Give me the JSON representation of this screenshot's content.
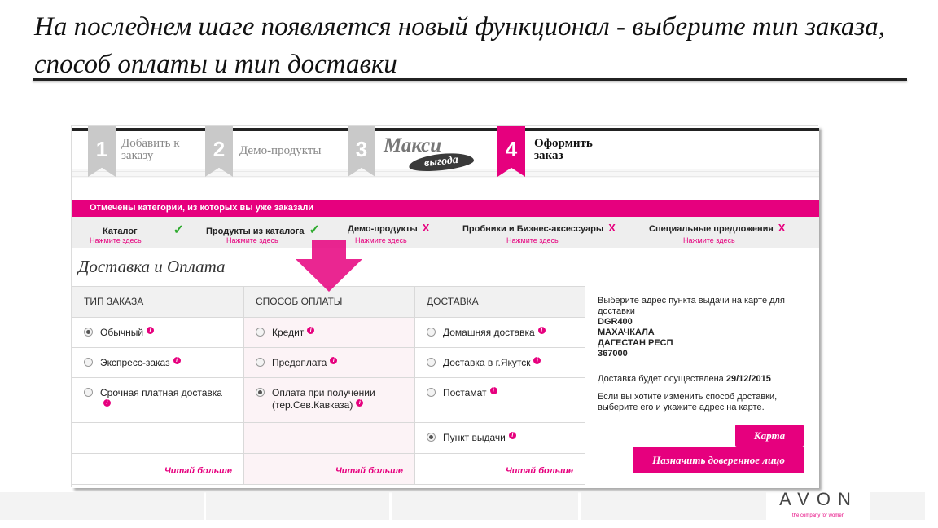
{
  "slide": {
    "title": "На последнем шаге появляется новый функционал -  выберите тип заказа, способ оплаты и тип доставки"
  },
  "steps": [
    {
      "num": "1",
      "label": "Добавить к заказу",
      "active": false
    },
    {
      "num": "2",
      "label": "Демо-продукты",
      "active": false
    },
    {
      "num": "3",
      "label": "Макси",
      "sub": "выгода",
      "active": false
    },
    {
      "num": "4",
      "label": "Оформить заказ",
      "active": true
    }
  ],
  "categories_banner": "Отмечены категории, из которых вы уже заказали",
  "categories": [
    {
      "name": "Каталог",
      "ordered": true,
      "link": "Нажмите здесь"
    },
    {
      "name": "Продукты из каталога",
      "ordered": true,
      "link": "Нажмите здесь"
    },
    {
      "name": "Демо-продукты",
      "ordered": false,
      "link": "Нажмите здесь"
    },
    {
      "name": "Пробники и Бизнес-аксессуары",
      "ordered": false,
      "link": "Нажмите здесь"
    },
    {
      "name": "Специальные предложения",
      "ordered": false,
      "link": "Нажмите здесь"
    }
  ],
  "marks": {
    "ok": "✓",
    "no": "X"
  },
  "section_title": "Доставка и Оплата",
  "columns": {
    "order_type": {
      "header": "ТИП ЗАКАЗА",
      "options": [
        {
          "label": "Обычный",
          "selected": true
        },
        {
          "label": "Экспресс-заказ",
          "selected": false
        },
        {
          "label": "Срочная платная доставка",
          "selected": false
        }
      ],
      "more": "Читай больше"
    },
    "payment": {
      "header": "СПОСОБ ОПЛАТЫ",
      "options": [
        {
          "label": "Кредит",
          "selected": false
        },
        {
          "label": "Предоплата",
          "selected": false
        },
        {
          "label": "Оплата при получении (тер.Сев.Кавказа)",
          "selected": true
        }
      ],
      "more": "Читай больше"
    },
    "delivery": {
      "header": "ДОСТАВКА",
      "options": [
        {
          "label": "Домашняя доставка",
          "selected": false
        },
        {
          "label": "Доставка в г.Якутск",
          "selected": false
        },
        {
          "label": "Постамат",
          "selected": false
        },
        {
          "label": "Пункт выдачи",
          "selected": true
        }
      ],
      "more": "Читай больше"
    }
  },
  "info_glyph": "i",
  "side": {
    "intro": "Выберите адрес пункта выдачи на карте для доставки",
    "addr1": "DGR400",
    "addr2": "МАХАЧКАЛА",
    "addr3": "ДАГЕСТАН РЕСП",
    "addr4": "367000",
    "delivery_note": "Доставка будет осуществлена",
    "delivery_date": "29/12/2015",
    "change_note": "Если вы хотите изменить способ доставки, выберите его и укажите адрес на карте.",
    "map_button": "Карта",
    "proxy_button": "Назначить доверенное лицо"
  },
  "brand": {
    "logo": "AVON",
    "tagline": "the company for women"
  },
  "colors": {
    "accent": "#e6007e",
    "check": "#2eaa2e"
  }
}
